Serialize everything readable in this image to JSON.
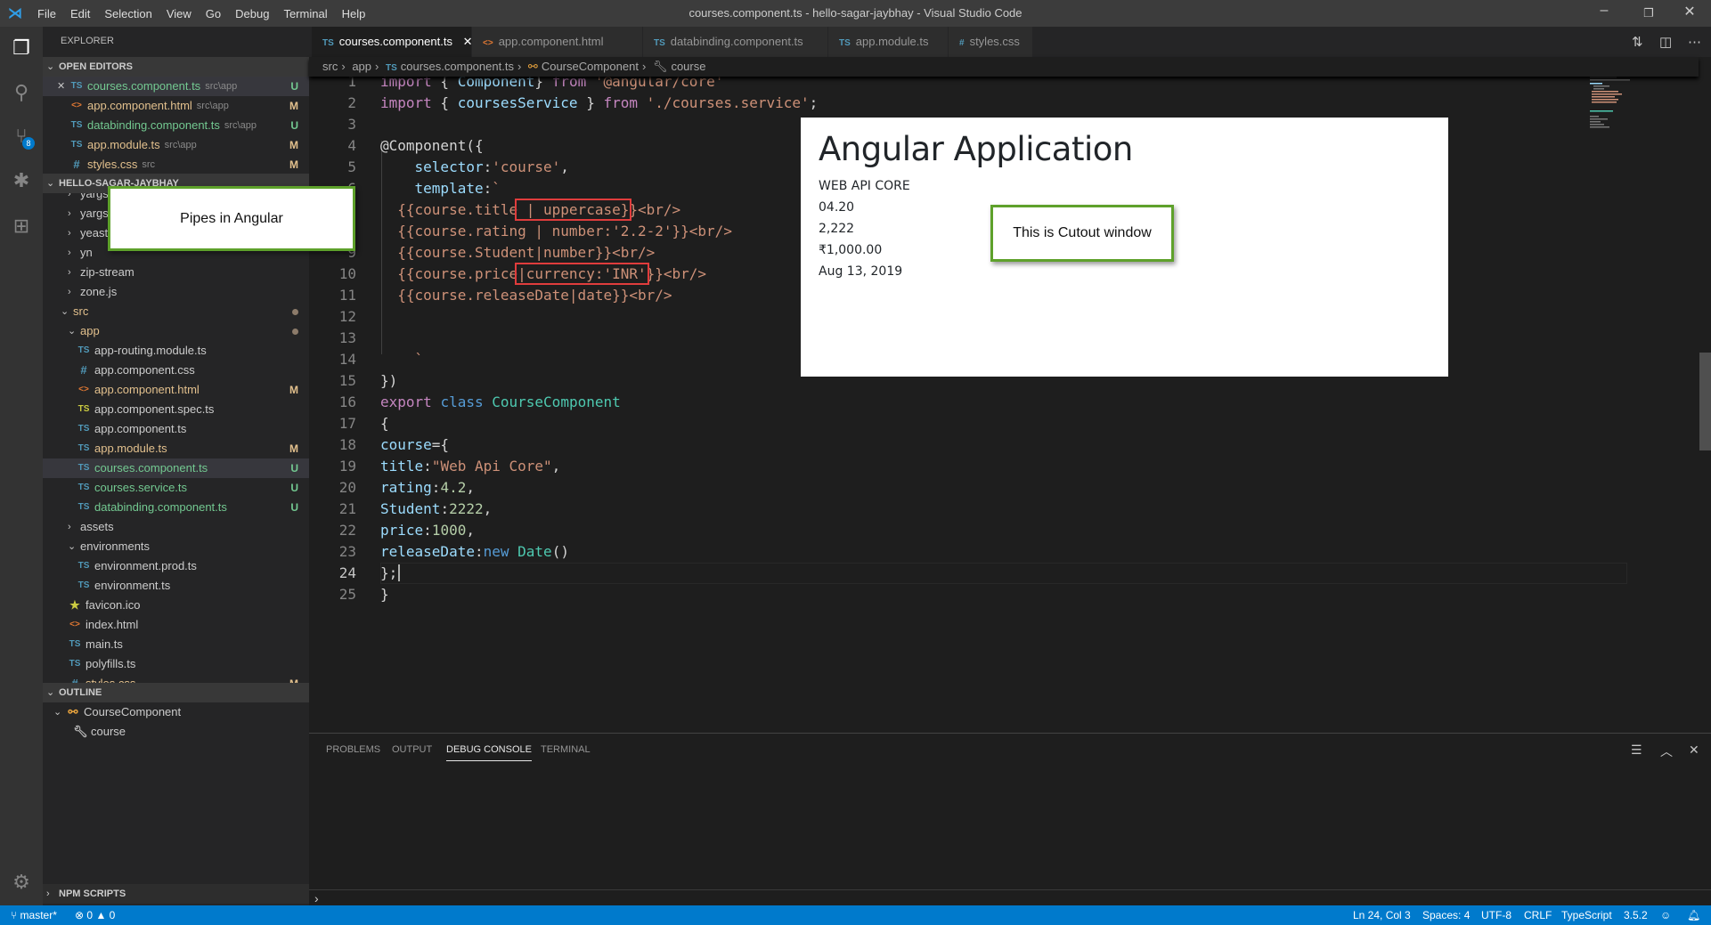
{
  "titlebar": {
    "title": "courses.component.ts - hello-sagar-jaybhay - Visual Studio Code",
    "logo": "vscode-logo",
    "menus": [
      "File",
      "Edit",
      "Selection",
      "View",
      "Go",
      "Debug",
      "Terminal",
      "Help"
    ]
  },
  "activity": {
    "scm_badge": "8"
  },
  "sidebar": {
    "title": "EXPLORER",
    "open_editors_header": "OPEN EDITORS",
    "open_editors": [
      {
        "icon": "TS",
        "type": "ts",
        "name": "courses.component.ts",
        "desc": "src\\app",
        "deco": "U",
        "color": "u",
        "active": true
      },
      {
        "icon": "<>",
        "type": "html",
        "name": "app.component.html",
        "desc": "src\\app",
        "deco": "M",
        "color": "m"
      },
      {
        "icon": "TS",
        "type": "ts",
        "name": "databinding.component.ts",
        "desc": "src\\app",
        "deco": "U",
        "color": "u"
      },
      {
        "icon": "TS",
        "type": "ts",
        "name": "app.module.ts",
        "desc": "src\\app",
        "deco": "M",
        "color": "m"
      },
      {
        "icon": "#",
        "type": "css",
        "name": "styles.css",
        "desc": "src",
        "deco": "M",
        "color": "m"
      }
    ],
    "project_header": "HELLO-SAGAR-JAYBHAY",
    "tree": [
      {
        "name": "yargs-parser",
        "level": 1,
        "folder": true,
        "open": false
      },
      {
        "name": "yargs",
        "level": 1,
        "folder": true,
        "open": false
      },
      {
        "name": "yeast",
        "level": 1,
        "folder": true,
        "open": false
      },
      {
        "name": "yn",
        "level": 1,
        "folder": true,
        "open": false
      },
      {
        "name": "zip-stream",
        "level": 1,
        "folder": true,
        "open": false
      },
      {
        "name": "zone.js",
        "level": 1,
        "folder": true,
        "open": false
      },
      {
        "name": "src",
        "level": 0,
        "folder": true,
        "open": true,
        "color": "m",
        "dot": true
      },
      {
        "name": "app",
        "level": 1,
        "folder": true,
        "open": true,
        "color": "m",
        "dot": true
      },
      {
        "name": "app-routing.module.ts",
        "level": 2,
        "icon": "TS",
        "type": "ts"
      },
      {
        "name": "app.component.css",
        "level": 2,
        "icon": "#",
        "type": "css"
      },
      {
        "name": "app.component.html",
        "level": 2,
        "icon": "<>",
        "type": "html",
        "deco": "M",
        "color": "m"
      },
      {
        "name": "app.component.spec.ts",
        "level": 2,
        "icon": "TS",
        "type": "tsy"
      },
      {
        "name": "app.component.ts",
        "level": 2,
        "icon": "TS",
        "type": "ts"
      },
      {
        "name": "app.module.ts",
        "level": 2,
        "icon": "TS",
        "type": "ts",
        "deco": "M",
        "color": "m"
      },
      {
        "name": "courses.component.ts",
        "level": 2,
        "icon": "TS",
        "type": "ts",
        "deco": "U",
        "color": "u",
        "selected": true
      },
      {
        "name": "courses.service.ts",
        "level": 2,
        "icon": "TS",
        "type": "ts",
        "deco": "U",
        "color": "u"
      },
      {
        "name": "databinding.component.ts",
        "level": 2,
        "icon": "TS",
        "type": "ts",
        "deco": "U",
        "color": "u"
      },
      {
        "name": "assets",
        "level": 1,
        "folder": true,
        "open": false
      },
      {
        "name": "environments",
        "level": 1,
        "folder": true,
        "open": true
      },
      {
        "name": "environment.prod.ts",
        "level": 2,
        "icon": "TS",
        "type": "ts"
      },
      {
        "name": "environment.ts",
        "level": 2,
        "icon": "TS",
        "type": "ts"
      },
      {
        "name": "favicon.ico",
        "level": 0,
        "icon": "★",
        "type": "star"
      },
      {
        "name": "index.html",
        "level": 0,
        "icon": "<>",
        "type": "html"
      },
      {
        "name": "main.ts",
        "level": 0,
        "icon": "TS",
        "type": "ts"
      },
      {
        "name": "polyfills.ts",
        "level": 0,
        "icon": "TS",
        "type": "ts"
      },
      {
        "name": "styles.css",
        "level": 0,
        "icon": "#",
        "type": "css",
        "deco": "M",
        "color": "m"
      }
    ],
    "outline_header": "OUTLINE",
    "outline": [
      {
        "name": "CourseComponent",
        "icon": "class-icon"
      },
      {
        "name": "course",
        "icon": "wrench-icon"
      }
    ],
    "npm_header": "NPM SCRIPTS"
  },
  "tabs": [
    {
      "icon": "TS",
      "label": "courses.component.ts",
      "active": true
    },
    {
      "icon": "<>",
      "label": "app.component.html"
    },
    {
      "icon": "TS",
      "label": "databinding.component.ts"
    },
    {
      "icon": "TS",
      "label": "app.module.ts"
    },
    {
      "icon": "#",
      "label": "styles.css"
    }
  ],
  "breadcrumbs": [
    "src",
    "app",
    "courses.component.ts",
    "CourseComponent",
    "course"
  ],
  "editor": {
    "current_line": 24,
    "lines": [
      [
        [
          "import",
          "k"
        ],
        [
          " { ",
          "p"
        ],
        [
          "Component",
          "v"
        ],
        [
          "} ",
          "p"
        ],
        [
          "from",
          "k"
        ],
        [
          " ",
          "p"
        ],
        [
          "'@angular/core'",
          "s"
        ]
      ],
      [
        [
          "import",
          "k"
        ],
        [
          " { ",
          "p"
        ],
        [
          "coursesService",
          "v"
        ],
        [
          " } ",
          "p"
        ],
        [
          "from",
          "k"
        ],
        [
          " ",
          "p"
        ],
        [
          "'./courses.service'",
          "s"
        ],
        [
          ";",
          "p"
        ]
      ],
      [],
      [
        [
          "@Component",
          "p"
        ],
        [
          "({",
          "p"
        ]
      ],
      [
        [
          "    ",
          "p"
        ],
        [
          "selector",
          "v"
        ],
        [
          ":",
          "p"
        ],
        [
          "'course'",
          "s"
        ],
        [
          ",",
          "p"
        ]
      ],
      [
        [
          "    ",
          "p"
        ],
        [
          "template",
          "v"
        ],
        [
          ":",
          "p"
        ],
        [
          "`",
          "s"
        ]
      ],
      [
        [
          "  {{course.title",
          "s"
        ],
        [
          " | uppercase}",
          "s",
          "box"
        ],
        [
          "}<br/>",
          "s"
        ]
      ],
      [
        [
          "  {{course.rating | number:'2.2-2'}}<br/>",
          "s"
        ]
      ],
      [
        [
          "  {{course.Student|number}}<br/>",
          "s"
        ]
      ],
      [
        [
          "  {{course.price",
          "s"
        ],
        [
          "|currency:'INR'",
          "s",
          "box"
        ],
        [
          "}}<br/>",
          "s"
        ]
      ],
      [
        [
          "  {{course.releaseDate|date}}<br/>",
          "s"
        ]
      ],
      [],
      [],
      [
        [
          "    `",
          "s"
        ]
      ],
      [
        [
          "})",
          "p"
        ]
      ],
      [
        [
          "export",
          "k"
        ],
        [
          " ",
          "p"
        ],
        [
          "class",
          "b"
        ],
        [
          " ",
          "p"
        ],
        [
          "CourseComponent",
          "t"
        ]
      ],
      [
        [
          "{",
          "p"
        ]
      ],
      [
        [
          "course",
          "v"
        ],
        [
          "={",
          "p"
        ]
      ],
      [
        [
          "title",
          "v"
        ],
        [
          ":",
          "p"
        ],
        [
          "\"Web Api Core\"",
          "s"
        ],
        [
          ",",
          "p"
        ]
      ],
      [
        [
          "rating",
          "v"
        ],
        [
          ":",
          "p"
        ],
        [
          "4.2",
          "n"
        ],
        [
          ",",
          "p"
        ]
      ],
      [
        [
          "Student",
          "v"
        ],
        [
          ":",
          "p"
        ],
        [
          "2222",
          "n"
        ],
        [
          ",",
          "p"
        ]
      ],
      [
        [
          "price",
          "v"
        ],
        [
          ":",
          "p"
        ],
        [
          "1000",
          "n"
        ],
        [
          ",",
          "p"
        ]
      ],
      [
        [
          "releaseDate",
          "v"
        ],
        [
          ":",
          "p"
        ],
        [
          "new",
          "b"
        ],
        [
          " ",
          "p"
        ],
        [
          "Date",
          "t"
        ],
        [
          "()",
          "p"
        ]
      ],
      [
        [
          "};",
          "p"
        ]
      ],
      [
        [
          "}",
          "p"
        ]
      ]
    ]
  },
  "preview": {
    "heading": "Angular Application",
    "lines": [
      "WEB API CORE",
      "04.20",
      "2,222",
      "₹1,000.00",
      "Aug 13, 2019"
    ]
  },
  "callouts": {
    "pipes": "Pipes in Angular",
    "cutout": "This is Cutout window"
  },
  "panel": {
    "tabs": [
      "PROBLEMS",
      "OUTPUT",
      "DEBUG CONSOLE",
      "TERMINAL"
    ],
    "active": "DEBUG CONSOLE",
    "prompt": "›"
  },
  "status": {
    "branch": "master*",
    "errors": "0",
    "warnings": "0",
    "position": "Ln 24, Col 3",
    "spaces": "Spaces: 4",
    "encoding": "UTF-8",
    "eol": "CRLF",
    "language": "TypeScript",
    "version": "3.5.2"
  },
  "colors": {
    "accent": "#007acc",
    "untracked": "#73c991",
    "modified": "#e2c08d",
    "callout_border": "#5ea12b",
    "highlight_box": "#e03c3c"
  }
}
